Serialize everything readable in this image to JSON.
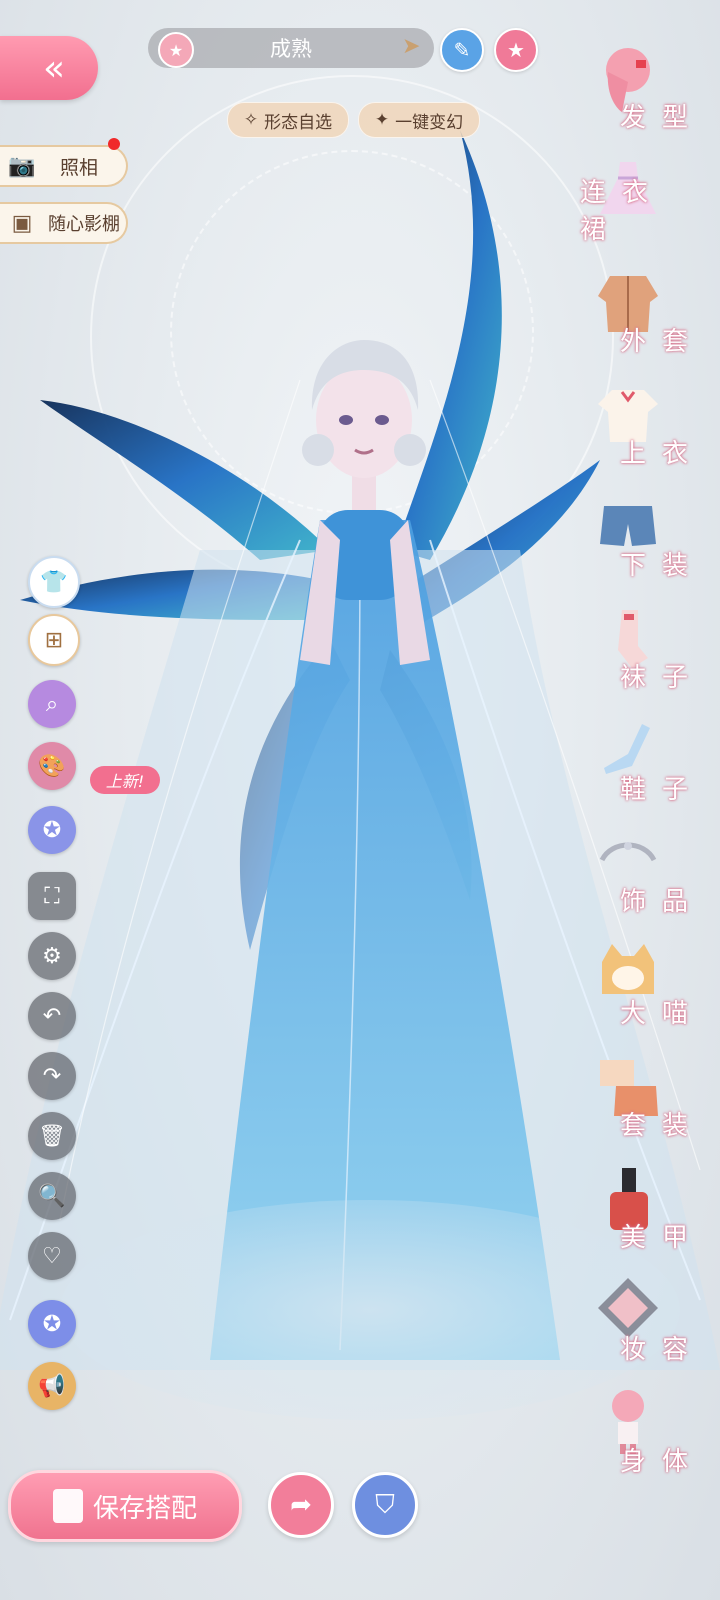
{
  "top_bar": {
    "back_icon": "double-chevron-left-icon",
    "style_label": "成熟",
    "edit_icon": "pencil-icon",
    "favorite_icon": "star-icon"
  },
  "chips": {
    "form_select": "形态自选",
    "one_key_transform": "一键变幻"
  },
  "left_panel": {
    "photo": "照相",
    "studio": "随心影棚",
    "new_badge": "上新!"
  },
  "right_menu": {
    "items": [
      {
        "label": "发型",
        "icon": "hair-icon"
      },
      {
        "label": "连衣裙",
        "icon": "dress-icon"
      },
      {
        "label": "外套",
        "icon": "coat-icon"
      },
      {
        "label": "上衣",
        "icon": "shirt-icon"
      },
      {
        "label": "下装",
        "icon": "shorts-icon"
      },
      {
        "label": "袜子",
        "icon": "socks-icon"
      },
      {
        "label": "鞋子",
        "icon": "shoe-icon"
      },
      {
        "label": "饰品",
        "icon": "accessory-icon"
      },
      {
        "label": "大喵",
        "icon": "cat-icon"
      },
      {
        "label": "套装",
        "icon": "outfit-set-icon"
      },
      {
        "label": "美甲",
        "icon": "nail-polish-icon"
      },
      {
        "label": "妆容",
        "icon": "makeup-icon"
      },
      {
        "label": "身体",
        "icon": "body-icon"
      }
    ]
  },
  "bottom_bar": {
    "save_label": "保存搭配"
  },
  "colors": {
    "accent_pink": "#f26f8f",
    "chip_beige": "#f0d6ba",
    "dress_blue": "#2f7fd0"
  }
}
